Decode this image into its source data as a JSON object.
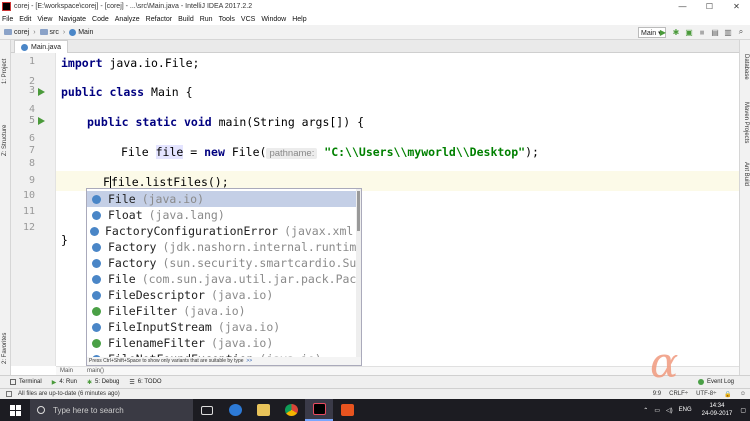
{
  "window": {
    "title": "corej - [E:\\workspace\\corej] - [corej] - ...\\src\\Main.java - IntelliJ IDEA 2017.2.2",
    "min": "—",
    "max": "☐",
    "close": "✕"
  },
  "menu": [
    "File",
    "Edit",
    "View",
    "Navigate",
    "Code",
    "Analyze",
    "Refactor",
    "Build",
    "Run",
    "Tools",
    "VCS",
    "Window",
    "Help"
  ],
  "nav": {
    "crumbs": [
      "corej",
      "src",
      "Main"
    ],
    "run_config": "Main ▾"
  },
  "left_strip": {
    "project": "1: Project",
    "structure": "Z: Structure",
    "favorites": "2: Favorites"
  },
  "right_strip": {
    "database": "Database",
    "maven": "Maven Projects",
    "ant": "Ant Build"
  },
  "tab": {
    "label": "Main.java"
  },
  "editor": {
    "line_numbers": [
      "1",
      "2",
      "3",
      "4",
      "5",
      "6",
      "7",
      "8",
      "9",
      "10",
      "11",
      "12"
    ],
    "line1_kw": "import",
    "line1_rest": " java.io.File;",
    "line3_kw1": "public",
    "line3_kw2": "class",
    "line3_rest": " Main {",
    "line5_kw1": "public",
    "line5_kw2": "static",
    "line5_kw3": "void",
    "line5_rest": " main(String args[]) {",
    "line7_a": "File ",
    "line7_var": "file",
    "line7_b": " = ",
    "line7_kw": "new",
    "line7_c": " File(",
    "line7_hint": "pathname:",
    "line7_str": "\"C:\\\\Users\\\\myworld\\\\Desktop\"",
    "line7_d": ");",
    "line9_a": "F",
    "line9_b": "file.listFiles();",
    "line11": "}"
  },
  "popup": {
    "items": [
      {
        "name": "File",
        "pkg": "(java.io)"
      },
      {
        "name": "Float",
        "pkg": "(java.lang)"
      },
      {
        "name": "FactoryConfigurationError",
        "pkg": "(javax.xml."
      },
      {
        "name": "Factory",
        "pkg": "(jdk.nashorn.internal.runtim"
      },
      {
        "name": "Factory",
        "pkg": "(sun.security.smartcardio.Su"
      },
      {
        "name": "File",
        "pkg": "(com.sun.java.util.jar.pack.Pac"
      },
      {
        "name": "FileDescriptor",
        "pkg": "(java.io)"
      },
      {
        "name": "FileFilter",
        "pkg": "(java.io)"
      },
      {
        "name": "FileInputStream",
        "pkg": "(java.io)"
      },
      {
        "name": "FilenameFilter",
        "pkg": "(java.io)"
      },
      {
        "name": "FileNotFoundException",
        "pkg": "(java.io)"
      }
    ],
    "footer": "Press Ctrl+Shift+Space to show only variants that are suitable by type",
    "footer_link": ">>"
  },
  "crumbbar": [
    "Main",
    "main()"
  ],
  "toolwindows": {
    "terminal": "Terminal",
    "run": "4: Run",
    "debug": "5: Debug",
    "todo": "6: TODO",
    "eventlog": "Event Log"
  },
  "status": {
    "message": "All files are up-to-date (6 minutes ago)",
    "position": "9:9",
    "line_sep": "CRLF÷",
    "encoding": "UTF-8÷"
  },
  "taskbar": {
    "search_placeholder": "Type here to search",
    "lang": "ENG",
    "time": "14:34",
    "date": "24-09-2017"
  },
  "watermark": "α"
}
